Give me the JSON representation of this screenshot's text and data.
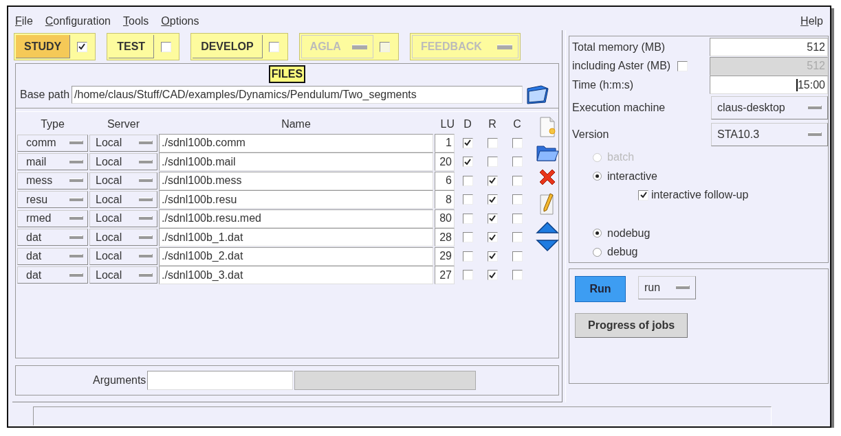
{
  "menu": [
    {
      "label": "File"
    },
    {
      "label": "Configuration"
    },
    {
      "label": "Tools"
    },
    {
      "label": "Options"
    }
  ],
  "help": {
    "label": "Help"
  },
  "modes": [
    {
      "label": "STUDY",
      "kind": "toggle",
      "selected": true,
      "checked": true,
      "disabled": false
    },
    {
      "label": "TEST",
      "kind": "toggle",
      "selected": false,
      "checked": false,
      "disabled": false
    },
    {
      "label": "DEVELOP",
      "kind": "toggle",
      "selected": false,
      "checked": false,
      "disabled": false
    },
    {
      "label": "AGLA",
      "kind": "menu-toggle",
      "selected": false,
      "checked": false,
      "disabled": true
    },
    {
      "label": "FEEDBACK",
      "kind": "menu",
      "selected": false,
      "disabled": true
    }
  ],
  "files": {
    "title": "FILES",
    "base_path_label": "Base path",
    "base_path": "/home/claus/Stuff/CAD/examples/Dynamics/Pendulum/Two_segments",
    "columns": [
      "Type",
      "Server",
      "Name",
      "LU",
      "D",
      "R",
      "C"
    ],
    "rows": [
      {
        "type": "comm",
        "server": "Local",
        "name": "./sdnl100b.comm",
        "lu": "1",
        "d": true,
        "r": false,
        "c": false
      },
      {
        "type": "mail",
        "server": "Local",
        "name": "./sdnl100b.mail",
        "lu": "20",
        "d": true,
        "r": false,
        "c": false
      },
      {
        "type": "mess",
        "server": "Local",
        "name": "./sdnl100b.mess",
        "lu": "6",
        "d": false,
        "r": true,
        "c": false
      },
      {
        "type": "resu",
        "server": "Local",
        "name": "./sdnl100b.resu",
        "lu": "8",
        "d": false,
        "r": true,
        "c": false
      },
      {
        "type": "rmed",
        "server": "Local",
        "name": "./sdnl100b.resu.med",
        "lu": "80",
        "d": false,
        "r": true,
        "c": false
      },
      {
        "type": "dat",
        "server": "Local",
        "name": "./sdnl100b_1.dat",
        "lu": "28",
        "d": false,
        "r": true,
        "c": false
      },
      {
        "type": "dat",
        "server": "Local",
        "name": "./sdnl100b_2.dat",
        "lu": "29",
        "d": false,
        "r": true,
        "c": false
      },
      {
        "type": "dat",
        "server": "Local",
        "name": "./sdnl100b_3.dat",
        "lu": "27",
        "d": false,
        "r": true,
        "c": false
      }
    ],
    "arguments_label": "Arguments"
  },
  "resources": {
    "memory": {
      "label": "Total memory (MB)",
      "value": "512"
    },
    "aster": {
      "label": "including Aster (MB)",
      "value": "512",
      "checked": false,
      "disabled": true
    },
    "time": {
      "label": "Time (h:m:s)",
      "value": "15:00"
    },
    "machine": {
      "label": "Execution machine",
      "value": "claus-desktop"
    },
    "version": {
      "label": "Version",
      "value": "STA10.3"
    },
    "run_modes": [
      {
        "label": "batch",
        "selected": false,
        "disabled": true
      },
      {
        "label": "interactive",
        "selected": true,
        "disabled": false
      }
    ],
    "follow_up": {
      "label": "interactive follow-up",
      "checked": true
    },
    "debug_modes": [
      {
        "label": "nodebug",
        "selected": true
      },
      {
        "label": "debug",
        "selected": false
      }
    ]
  },
  "run": {
    "run_button": "Run",
    "run_mode": "run",
    "progress_button": "Progress of jobs"
  }
}
